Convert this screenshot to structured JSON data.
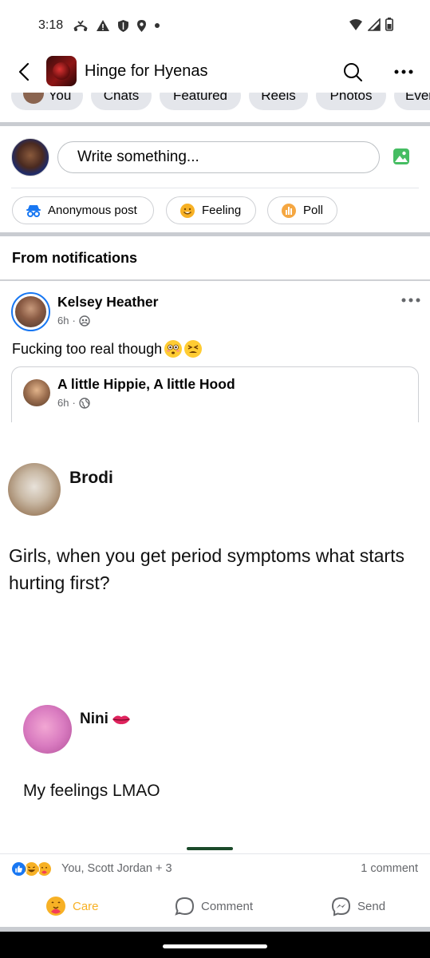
{
  "status_bar": {
    "time": "3:18"
  },
  "header": {
    "title": "Hinge for Hyenas"
  },
  "chips": [
    "You",
    "Chats",
    "Featured",
    "Reels",
    "Photos",
    "Events"
  ],
  "composer": {
    "placeholder": "Write something...",
    "actions": {
      "anonymous": "Anonymous post",
      "feeling": "Feeling",
      "poll": "Poll"
    }
  },
  "section": {
    "title": "From notifications"
  },
  "post": {
    "author": "Kelsey Heather",
    "time": "6h",
    "text": "Fucking too real though",
    "shared": {
      "author": "A little Hippie, A little Hood",
      "time": "6h"
    },
    "image": {
      "author1": "Brodi",
      "text1": "Girls, when you get period symptoms what starts hurting first?",
      "author2": "Nini",
      "text2": "My feelings LMAO"
    },
    "reactions_text": "You, Scott Jordan + 3",
    "comments_text": "1 comment",
    "actions": {
      "care": "Care",
      "comment": "Comment",
      "send": "Send"
    }
  },
  "colors": {
    "accent_blue": "#1877f2",
    "care_yellow": "#f7b125",
    "photo_green": "#45bd62"
  }
}
